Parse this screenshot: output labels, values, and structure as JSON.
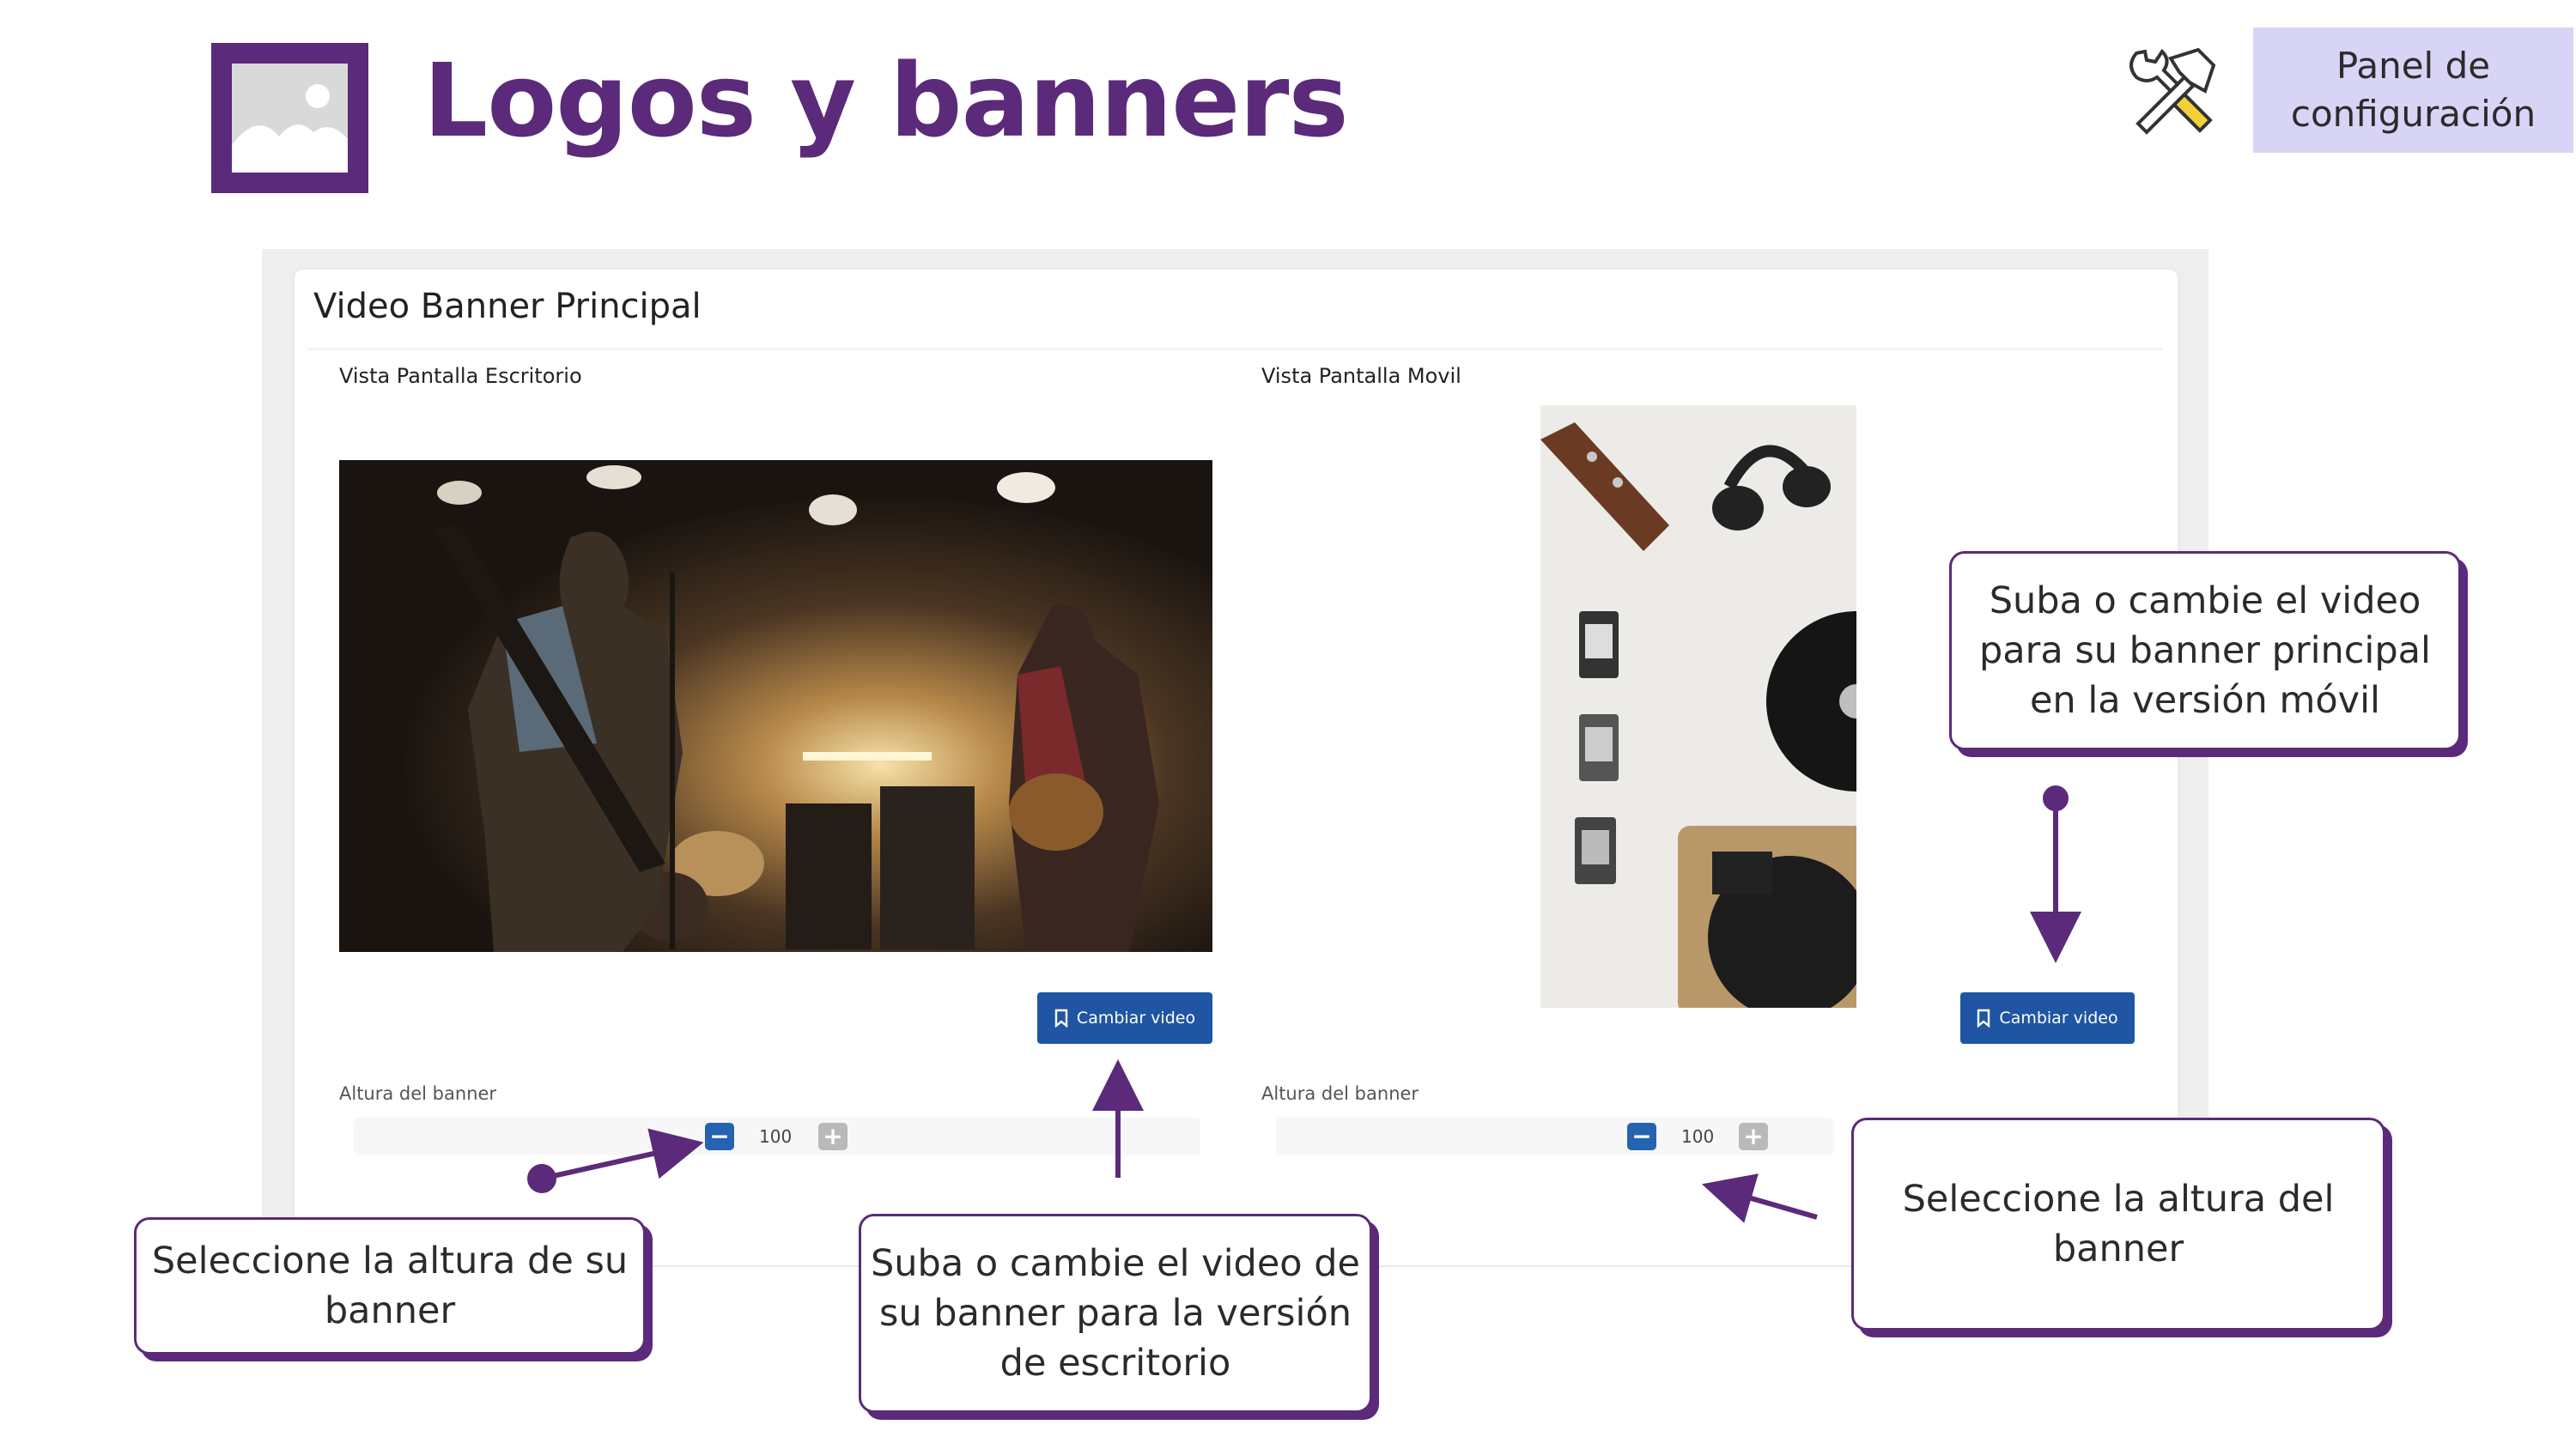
{
  "header": {
    "title": "Logos y banners",
    "config_button": "Panel de configuración",
    "logo_icon": "image-placeholder-icon",
    "tools_icon": "hammer-wrench-icon"
  },
  "panel": {
    "title": "Video Banner Principal",
    "desktop": {
      "label": "Vista Pantalla Escritorio",
      "change_button": "Cambiar video",
      "height_label": "Altura del banner",
      "height_value": "100",
      "minus": "−",
      "plus": "+"
    },
    "mobile": {
      "label": "Vista Pantalla Movil",
      "change_button": "Cambiar video",
      "height_label": "Altura del banner",
      "height_value": "100",
      "minus": "−",
      "plus": "+"
    }
  },
  "callouts": {
    "mobile_video": "Suba o cambie el video para su banner principal en la versión móvil",
    "mobile_height": "Seleccione la altura del banner",
    "desktop_height": "Seleccione la altura de su banner",
    "desktop_video": "Suba o cambie el video de su banner para la versión de escritorio"
  },
  "colors": {
    "brand_purple": "#5b2a7a",
    "config_bg": "#d8d4f6",
    "button_blue": "#1f55a3"
  }
}
